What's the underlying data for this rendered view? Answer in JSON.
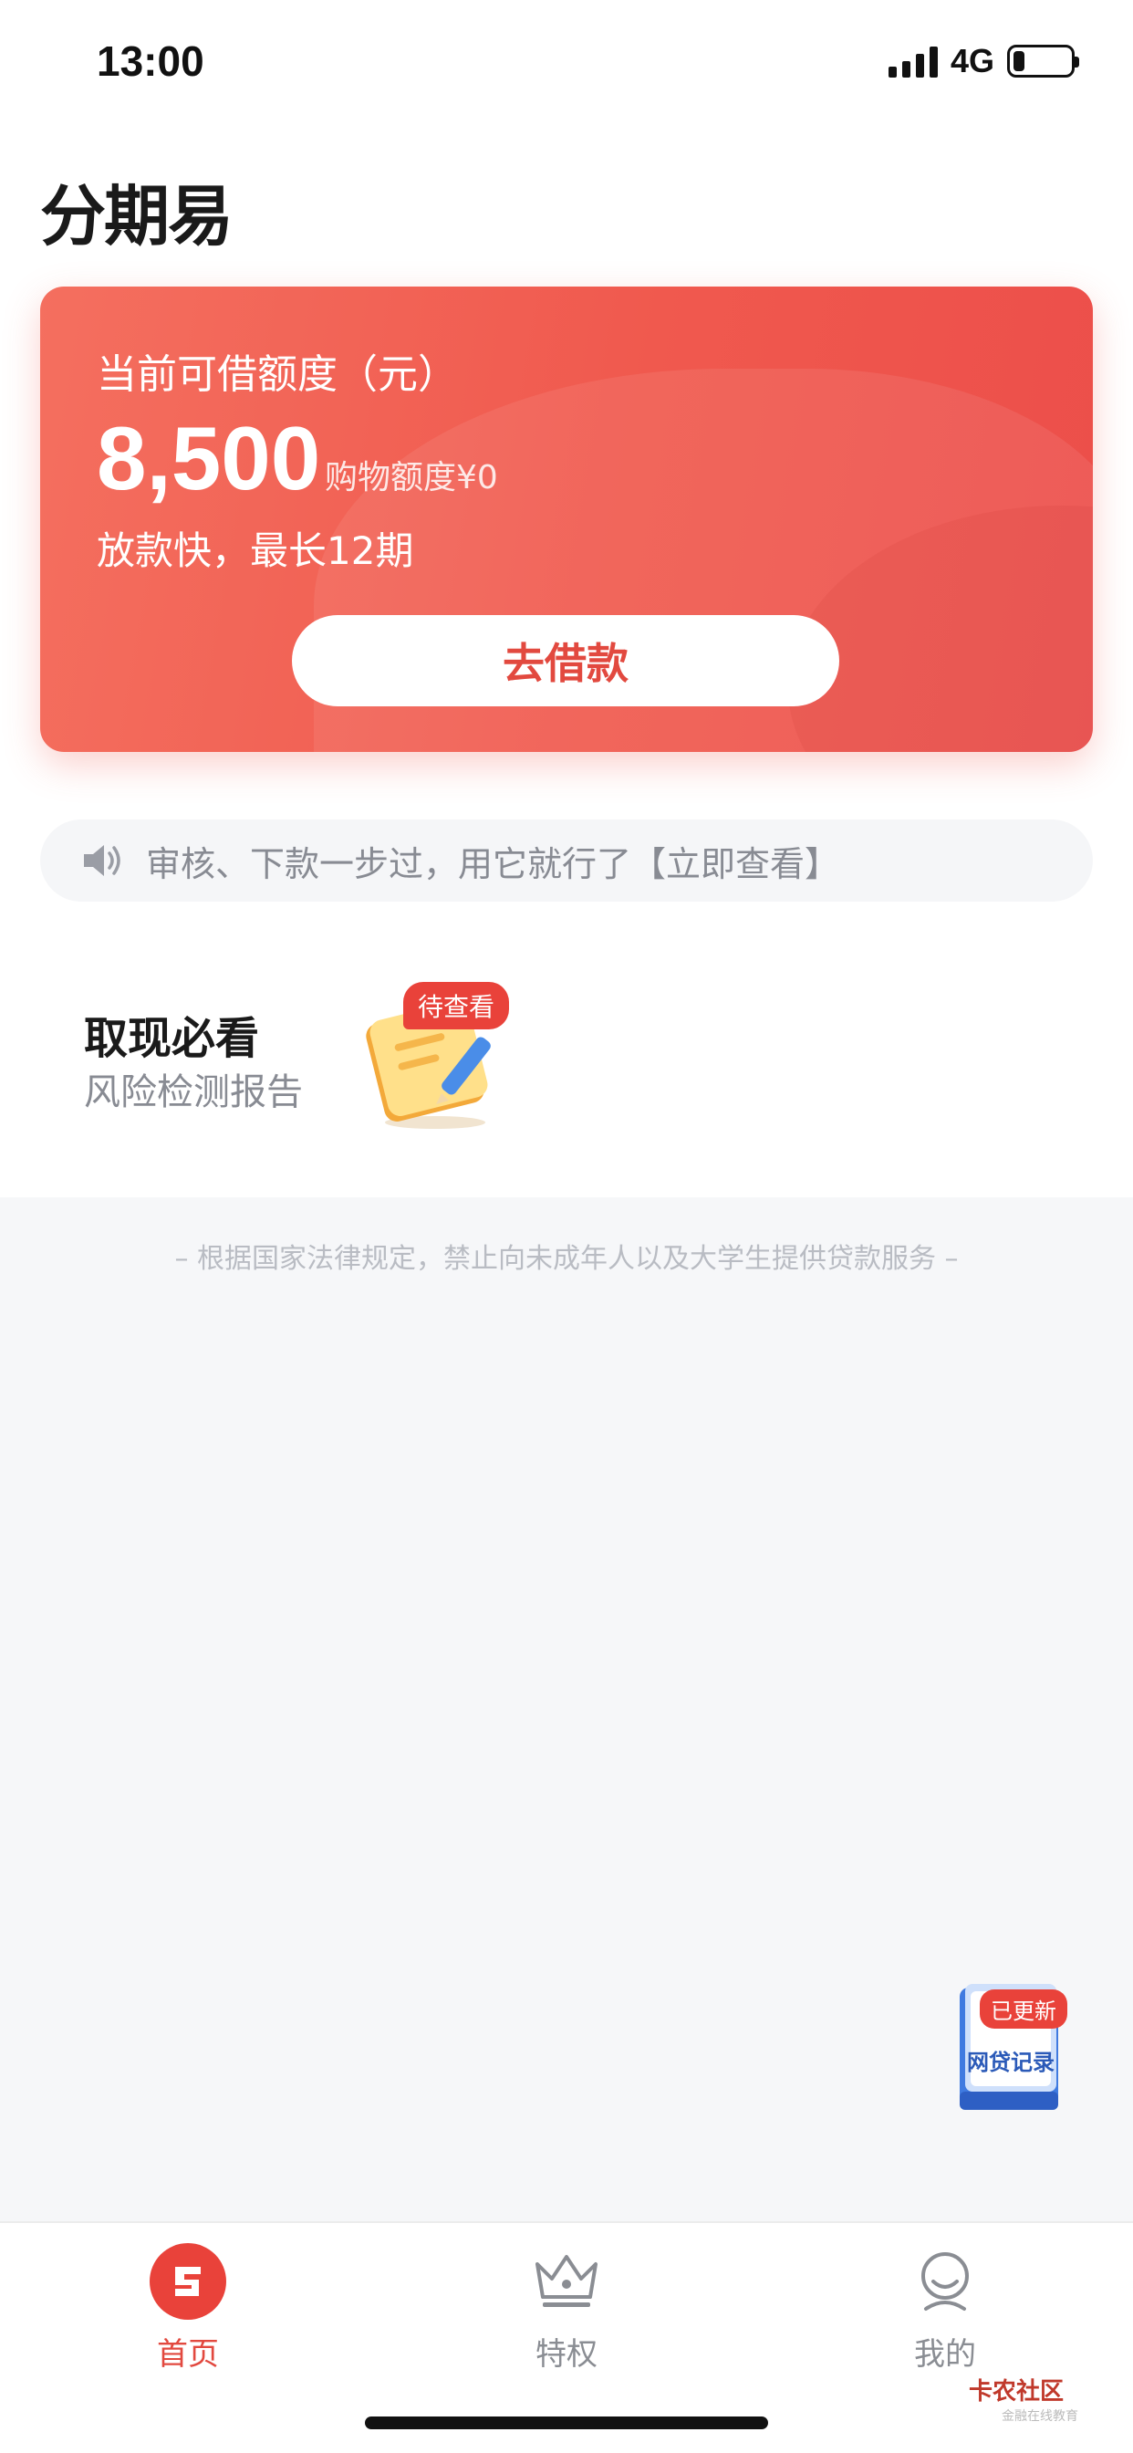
{
  "status_bar": {
    "time": "13:00",
    "network": "4G",
    "battery_percent": 20
  },
  "header": {
    "logo_text": "分期易"
  },
  "credit_card": {
    "label": "当前可借额度（元）",
    "amount": "8,500",
    "shopping_quota": "购物额度¥0",
    "subtitle": "放款快，最长12期",
    "borrow_button": "去借款"
  },
  "notice": {
    "text": "审核、下款一步过，用它就行了【立即查看】",
    "icon": "speaker-icon"
  },
  "feature": {
    "title": "取现必看",
    "subtitle": "风险检测报告",
    "badge": "待查看",
    "icon": "notepad-icon"
  },
  "legal_notice": "– 根据国家法律规定，禁止向未成年人以及大学生提供贷款服务 –",
  "floating_widget": {
    "badge": "已更新",
    "label": "网贷记录"
  },
  "tabbar": {
    "tabs": [
      {
        "label": "首页",
        "icon": "home-icon",
        "active": true
      },
      {
        "label": "特权",
        "icon": "crown-icon",
        "active": false
      },
      {
        "label": "我的",
        "icon": "profile-icon",
        "active": false
      }
    ]
  },
  "watermark": {
    "text": "卡农社区",
    "sub": "金融在线教育"
  },
  "colors": {
    "accent": "#e9423a",
    "card_start": "#f46f5f",
    "card_end": "#ec4e4a",
    "muted": "#888b93"
  }
}
